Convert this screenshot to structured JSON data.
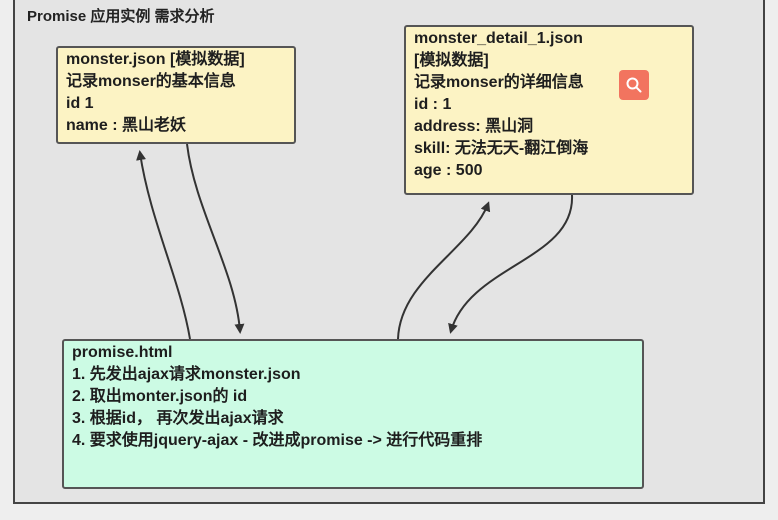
{
  "title": "Promise 应用实例 需求分析",
  "boxes": {
    "monster": {
      "lines": [
        "monster.json [模拟数据]",
        "记录monser的基本信息",
        "id  1",
        "name : 黑山老妖"
      ]
    },
    "detail": {
      "lines": [
        "monster_detail_1.json",
        "[模拟数据]",
        "记录monser的详细信息",
        "id : 1",
        "address: 黑山洞",
        "skill: 无法无天-翻江倒海",
        "age : 500"
      ]
    },
    "promise": {
      "lines": [
        "promise.html",
        "1. 先发出ajax请求monster.json",
        "2. 取出monter.json的 id",
        "3. 根据id， 再次发出ajax请求",
        "4. 要求使用jquery-ajax - 改进成promise -> 进行代码重排"
      ]
    }
  },
  "icons": {
    "search": "search-icon"
  },
  "colors": {
    "json_box": "#fcf3c4",
    "html_box": "#ccfbe4",
    "search_button": "#f2745f"
  }
}
